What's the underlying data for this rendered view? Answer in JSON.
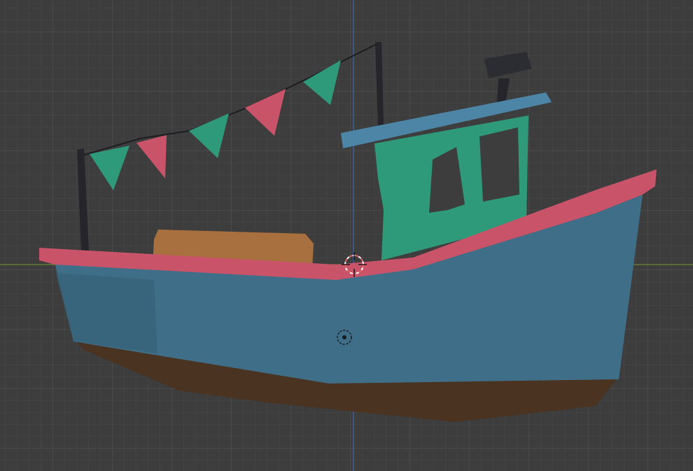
{
  "viewport": {
    "background_color": "#3d3d3d",
    "grid_color": "#4a4a4a",
    "axis_x_color": "#6f9a2b",
    "axis_z_color": "#3b73c9"
  },
  "model": {
    "hull_color": "#3f6f88",
    "hull_bottom_color": "#4a3320",
    "rail_color": "#c9546a",
    "cabin_color": "#2f9a7a",
    "cabin_roof_color": "#4c85a6",
    "crate_color": "#a8703e",
    "mast_color": "#25252b",
    "flag_colors": [
      "#2f9a7a",
      "#c9546a"
    ]
  },
  "cursor": {
    "icon": "3d-cursor-icon",
    "color": "#e06060"
  },
  "origin": {
    "icon": "object-origin-icon"
  }
}
